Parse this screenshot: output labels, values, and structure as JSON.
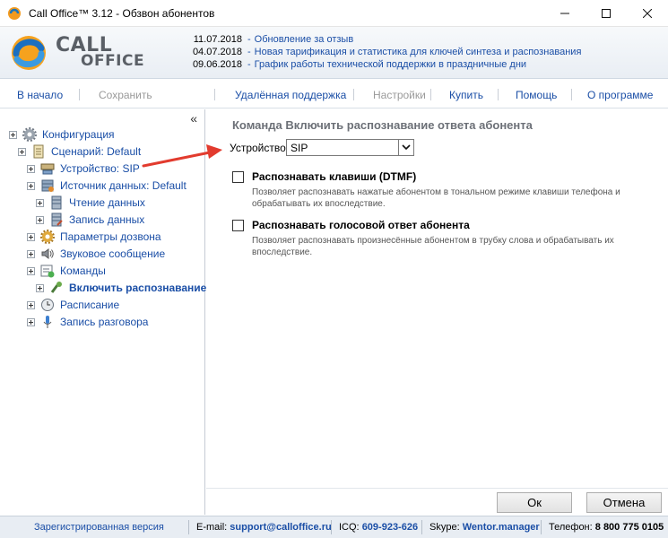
{
  "window": {
    "title": "Call Office™ 3.12 - Обзвон абонентов",
    "controls": [
      "minimize-icon",
      "maximize-icon",
      "close-icon"
    ]
  },
  "logo": {
    "line1": "CALL",
    "line2": "OFFICE"
  },
  "news": [
    {
      "date": "11.07.2018",
      "text": "Обновление за отзыв"
    },
    {
      "date": "04.07.2018",
      "text": "Новая тарификация и статистика для ключей синтеза и распознавания"
    },
    {
      "date": "09.06.2018",
      "text": "График работы технической поддержки в праздничные дни"
    }
  ],
  "menu": [
    {
      "label": "В начало",
      "enabled": true
    },
    {
      "label": "Сохранить",
      "enabled": false
    },
    {
      "label": "Удалённая поддержка",
      "enabled": true
    },
    {
      "label": "Настройки",
      "enabled": false
    },
    {
      "label": "Купить",
      "enabled": true
    },
    {
      "label": "Помощь",
      "enabled": true
    },
    {
      "label": "О программе",
      "enabled": true
    }
  ],
  "tree": {
    "collapse_glyph": "«",
    "items": [
      {
        "label": "Конфигурация",
        "icon": "gear-icon"
      },
      {
        "label": "Сценарий: Default",
        "icon": "document-icon"
      },
      {
        "label": "Устройство: SIP",
        "icon": "device-icon"
      },
      {
        "label": "Источник данных: Default",
        "icon": "database-icon"
      },
      {
        "label": "Чтение данных",
        "icon": "database-read-icon"
      },
      {
        "label": "Запись данных",
        "icon": "database-write-icon"
      },
      {
        "label": "Параметры дозвона",
        "icon": "settings-icon"
      },
      {
        "label": "Звуковое сообщение",
        "icon": "speaker-icon"
      },
      {
        "label": "Команды",
        "icon": "commands-icon"
      },
      {
        "label": "Включить распознавание",
        "icon": "recognition-icon"
      },
      {
        "label": "Расписание",
        "icon": "clock-icon"
      },
      {
        "label": "Запись разговора",
        "icon": "microphone-icon"
      }
    ]
  },
  "content": {
    "title": "Команда Включить распознавание ответа абонента",
    "device_label": "Устройство:",
    "device_value": "SIP",
    "options": [
      {
        "title": "Распознавать клавиши (DTMF)",
        "checked": false,
        "description": "Позволяет распознавать нажатые абонентом в тональном режиме клавиши телефона и обрабатывать их впоследствие."
      },
      {
        "title": "Распознавать голосовой ответ абонента",
        "checked": false,
        "description": "Позволяет распознавать произнесённые абонентом в трубку слова и обрабатывать их впоследствие."
      }
    ]
  },
  "buttons": {
    "ok": "Ок",
    "cancel": "Отмена"
  },
  "status": {
    "registered": "Зарегистрированная версия",
    "email_label": "E-mail:",
    "email": "support@calloffice.ru",
    "icq_label": "ICQ:",
    "icq": "609-923-626",
    "skype_label": "Skype:",
    "skype": "Wentor.manager",
    "phone_label": "Телефон:",
    "phone": "8 800 775 0105"
  },
  "colors": {
    "link": "#1a4ea6",
    "annotation_arrow": "#e23b2e"
  }
}
